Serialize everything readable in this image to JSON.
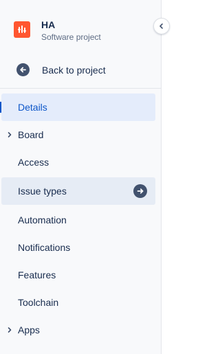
{
  "project": {
    "name": "HA",
    "type": "Software project",
    "avatar_color": "#ff5630"
  },
  "back_link": {
    "label": "Back to project",
    "icon": "arrow-left-circle-icon"
  },
  "collapse_button": {
    "icon": "chevron-left-icon"
  },
  "nav": {
    "items": [
      {
        "label": "Details",
        "state": "selected"
      },
      {
        "label": "Board",
        "expandable": true
      },
      {
        "label": "Access"
      },
      {
        "label": "Issue types",
        "state": "hovered",
        "trailing_icon": "arrow-right-circle-icon"
      },
      {
        "label": "Automation"
      },
      {
        "label": "Notifications"
      },
      {
        "label": "Features"
      },
      {
        "label": "Toolchain"
      },
      {
        "label": "Apps",
        "expandable": true
      }
    ]
  },
  "colors": {
    "accent": "#0c56c9",
    "selected_bg": "#e4ecfb",
    "text": "#172b4d",
    "muted_text": "#5e6c84",
    "sidebar_bg": "#f8f9fb"
  }
}
